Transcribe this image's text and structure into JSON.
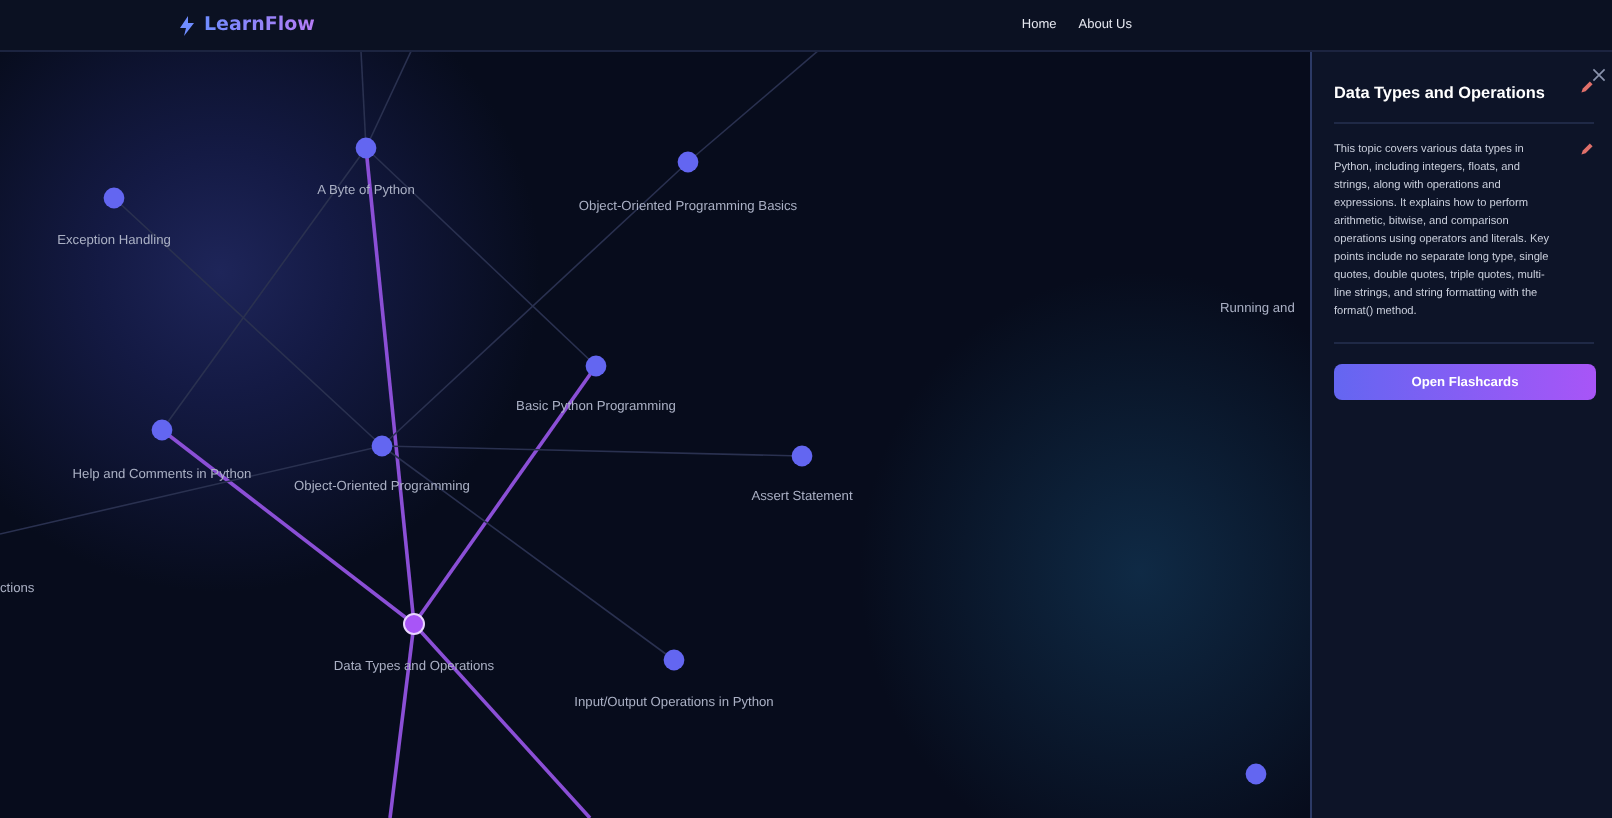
{
  "header": {
    "logo": "LearnFlow",
    "nav": [
      "Home",
      "About Us"
    ]
  },
  "graph": {
    "nodes": [
      {
        "label": "A Byte of Python",
        "selected": false
      },
      {
        "label": "Object-Oriented Programming Basics",
        "selected": false
      },
      {
        "label": "Exception Handling",
        "selected": false
      },
      {
        "label": "Basic Python Programming",
        "selected": false
      },
      {
        "label": "Help and Comments in Python",
        "selected": false
      },
      {
        "label": "Object-Oriented Programming",
        "selected": false
      },
      {
        "label": "Assert Statement",
        "selected": false
      },
      {
        "label": "ctions"
      },
      {
        "label": "Data Types and Operations",
        "selected": true
      },
      {
        "label": "Input/Output Operations in Python",
        "selected": false
      },
      {
        "label": "Running and"
      },
      {
        "selected": false
      }
    ]
  },
  "panel": {
    "title": "Data Types and Operations",
    "description": "This topic covers various data types in Python, including integers, floats, and strings, along with operations and expressions. It explains how to perform arithmetic, bitwise, and comparison operations using operators and literals. Key points include no separate long type, single quotes, double quotes, triple quotes, multi-line strings, and string formatting with the format() method.",
    "button": "Open Flashcards"
  }
}
